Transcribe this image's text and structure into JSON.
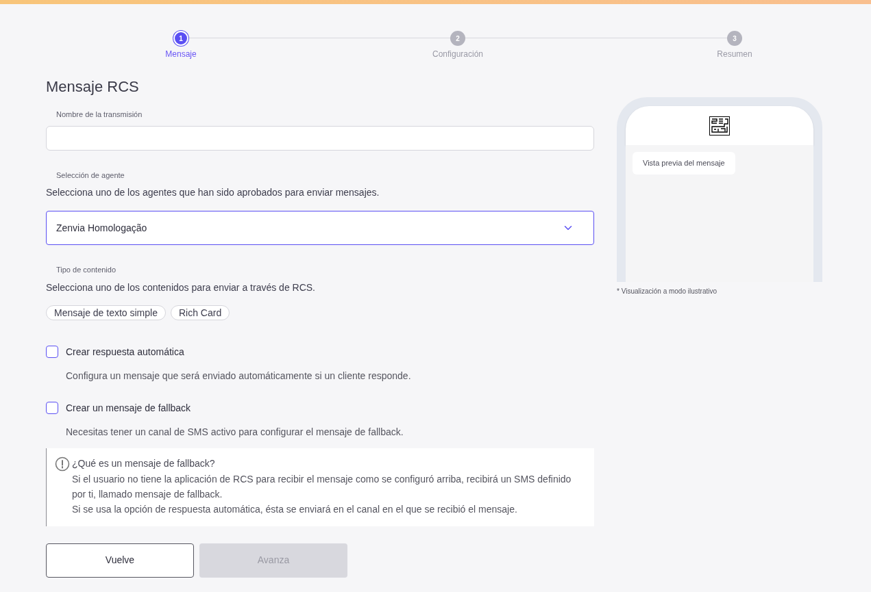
{
  "steps": [
    {
      "number": "1",
      "label": "Mensaje",
      "selected": true
    },
    {
      "number": "2",
      "label": "Configuración",
      "selected": false
    },
    {
      "number": "3",
      "label": "Resumen",
      "selected": false
    }
  ],
  "title": "Mensaje RCS",
  "broadcast_name": {
    "label": "Nombre de la transmisión"
  },
  "agent": {
    "label": "Selección de agente",
    "description": "Selecciona uno de los agentes que han sido aprobados para enviar mensajes.",
    "value": "Zenvia Homologação"
  },
  "content_type": {
    "label": "Tipo de contenido",
    "description": "Selecciona uno de los contenidos para enviar a través de RCS.",
    "options": [
      {
        "label": "Mensaje de texto simple",
        "selected": false
      },
      {
        "label": "Rich Card",
        "selected": false
      }
    ]
  },
  "options": [
    {
      "label": "Crear respuesta automática",
      "description": "Configura un mensaje que será enviado automáticamente si un cliente responde.",
      "checked": false
    },
    {
      "label": "Crear un mensaje de fallback",
      "description": "Necesitas tener un canal de SMS activo para configurar el mensaje de fallback.",
      "checked": false
    }
  ],
  "info": {
    "title": "¿Qué es un mensaje de fallback?",
    "paragraphs": [
      "Si el usuario no tiene la aplicación de RCS para recibir el mensaje como se configuró arriba, recibirá un SMS definido por ti, llamado mensaje de fallback.",
      "Si se usa la opción de respuesta automática, ésta se enviará en el canal en el que se recibió el mensaje."
    ]
  },
  "buttons": [
    {
      "label": "Vuelve",
      "disabled": false
    },
    {
      "label": "Avanza",
      "disabled": true
    }
  ],
  "preview": {
    "bubble": "Vista previa del mensaje",
    "note": "* Visualización a modo ilustrativo"
  }
}
